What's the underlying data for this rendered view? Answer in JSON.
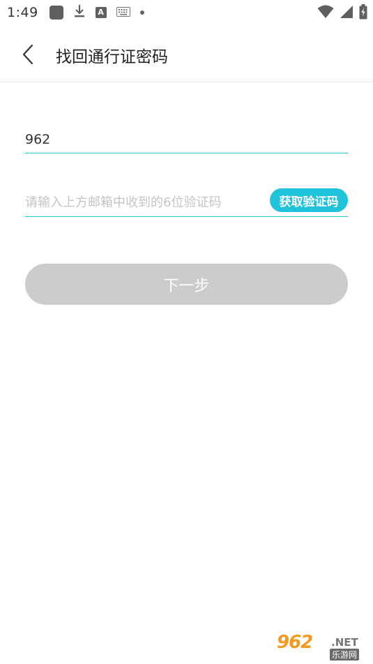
{
  "status_bar": {
    "time": "1:49",
    "icons": [
      "app-square-icon",
      "download-icon",
      "font-a-icon",
      "keyboard-icon",
      "dot-icon",
      "wifi-icon",
      "signal-icon",
      "battery-icon"
    ],
    "font_letter": "A"
  },
  "header": {
    "title": "找回通行证密码",
    "back_icon": "chevron-left-icon"
  },
  "form": {
    "email_value": "962",
    "code_placeholder": "请输入上方邮箱中收到的6位验证码",
    "code_value": "",
    "get_code_label": "获取验证码",
    "next_label": "下一步"
  },
  "watermark": {
    "digits": "962",
    "net": ".NET",
    "sub": "乐游网"
  },
  "colors": {
    "accent": "#1fc3db",
    "disabled_button": "#cccccc",
    "title_text": "#222222",
    "placeholder": "#c4c4c4"
  }
}
